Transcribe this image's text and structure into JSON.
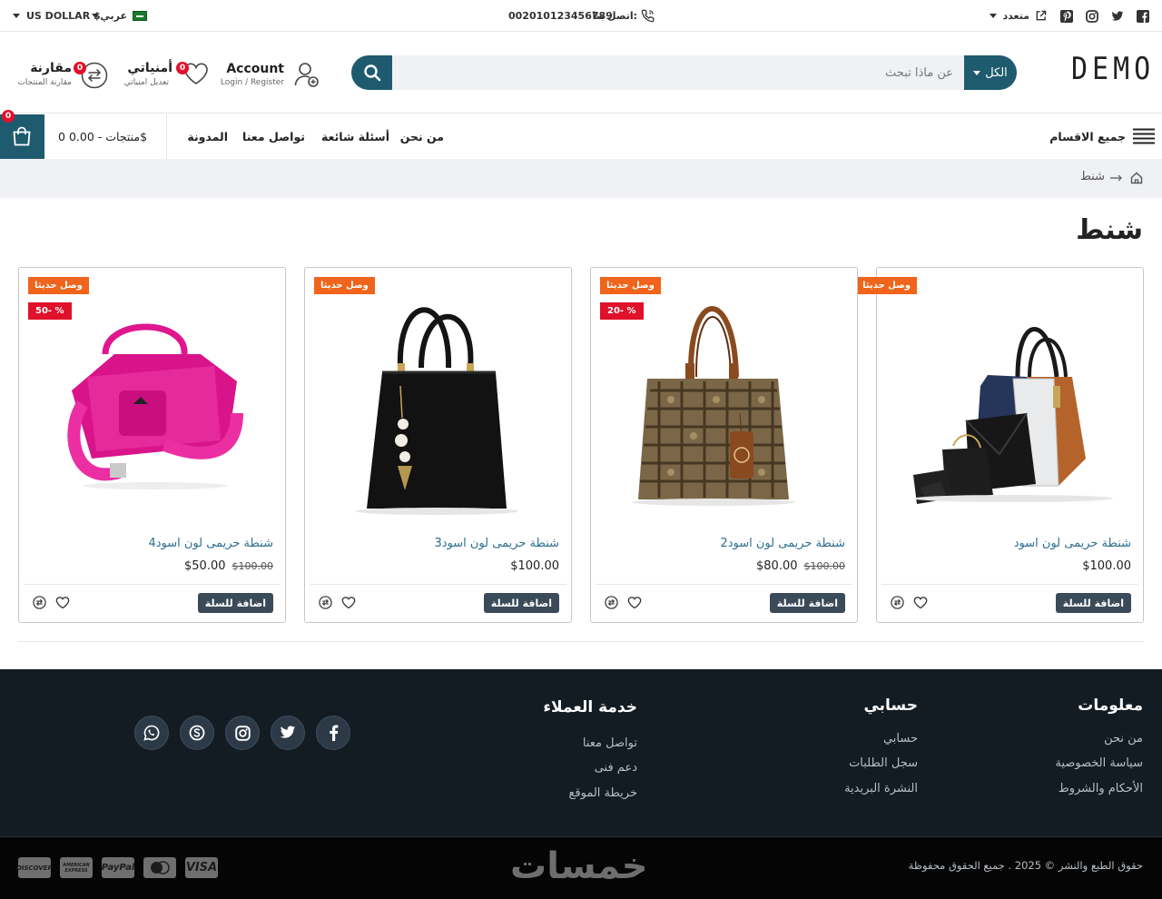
{
  "topbar": {
    "social": [
      "facebook-icon",
      "twitter-icon",
      "instagram-icon",
      "pinterest-icon"
    ],
    "multi_label": "متعدد",
    "contact_label": "اتصل بنا:",
    "phone": "002010123456789",
    "language": "عربي",
    "currency": "US DOLLAR $"
  },
  "header": {
    "logo": "DEMO",
    "search": {
      "category": "الكل",
      "placeholder": "عن ماذا تبحث"
    },
    "account": {
      "title": "Account",
      "subtitle": "Login / Register"
    },
    "wishlist": {
      "title": "أمنياتي",
      "subtitle": "تعديل امنياتي",
      "count": "0"
    },
    "compare": {
      "title": "مقارنة",
      "subtitle": "مقارنة المنتجات",
      "count": "0"
    }
  },
  "nav": {
    "categories_label": "جميع الاقسام",
    "links": [
      "من نحن",
      "أسئلة شائعة",
      "تواصل معنا",
      "المدونة"
    ],
    "cart_summary": "0 منتجات - 0.00$",
    "cart_count": "0"
  },
  "breadcrumb": {
    "current": "شنط"
  },
  "page": {
    "title": "شنط"
  },
  "products": [
    {
      "name": "شنطة حريمى لون اسود",
      "price": "$100.00",
      "old_price": "",
      "new_badge": "وصل حديثا",
      "discount": "",
      "add_label": "اضافة للسلة"
    },
    {
      "name": "شنطة حريمى لون اسود2",
      "price": "$80.00",
      "old_price": "$100.00",
      "new_badge": "وصل حديثا",
      "discount": "20- %",
      "add_label": "اضافة للسلة"
    },
    {
      "name": "شنطة حريمى لون اسود3",
      "price": "$100.00",
      "old_price": "",
      "new_badge": "وصل حديثا",
      "discount": "",
      "add_label": "اضافة للسلة"
    },
    {
      "name": "شنطة حريمى لون اسود4",
      "price": "$50.00",
      "old_price": "$100.00",
      "new_badge": "وصل حديثا",
      "discount": "50- %",
      "add_label": "اضافة للسلة"
    }
  ],
  "footer": {
    "info": {
      "title": "معلومات",
      "links": [
        "من نحن",
        "سياسة الخصوصية",
        "الأحكام والشروط"
      ]
    },
    "account": {
      "title": "حسابي",
      "links": [
        "حسابي",
        "سجل الطلبات",
        "النشرة البريدية"
      ]
    },
    "service": {
      "title": "خدمة العملاء",
      "links": [
        "تواصل معنا",
        "دعم فنى",
        "خريطة الموقع"
      ]
    },
    "social": [
      "facebook-icon",
      "twitter-icon",
      "instagram-icon",
      "skype-icon",
      "whatsapp-icon"
    ],
    "copyright": "حقوق الطبع والنشر © 2025 . جميع الحقوق محفوظة",
    "brand": "خمسات",
    "payments": [
      "VISA",
      "MasterCard",
      "PayPal",
      "AMERICAN EXPRESS",
      "DISCOVER"
    ]
  },
  "colors": {
    "primary": "#1e5b6e",
    "badge_new": "#f0641b",
    "badge_discount": "#e0112b",
    "footer_bg": "#131b23"
  }
}
